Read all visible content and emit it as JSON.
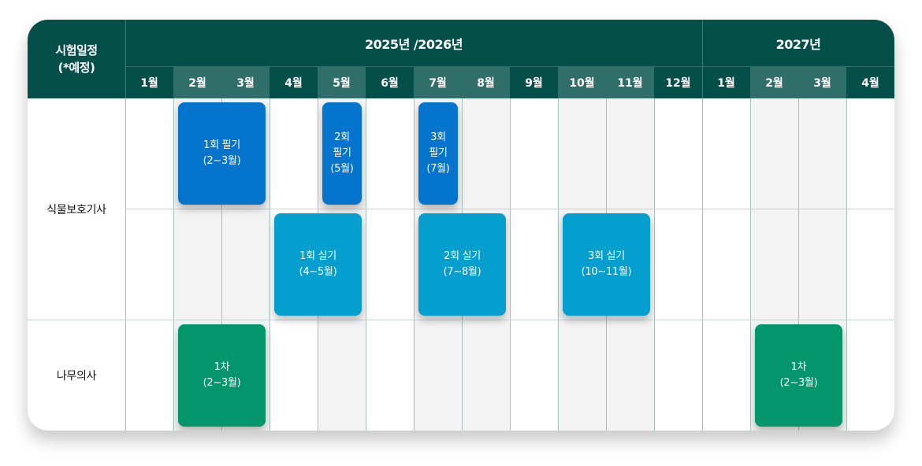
{
  "header": {
    "corner_line1": "시험일정",
    "corner_line2": "(*예정)",
    "year_range_label": "2025년 /2026년",
    "year_next_label": "2027년",
    "months": [
      "1월",
      "2월",
      "3월",
      "4월",
      "5월",
      "6월",
      "7월",
      "8월",
      "9월",
      "10월",
      "11월",
      "12월",
      "1월",
      "2월",
      "3월",
      "4월"
    ]
  },
  "rows": [
    {
      "label": "식물보호기사"
    },
    {
      "label": "나무의사"
    }
  ],
  "blocks": {
    "written1": {
      "lines": [
        "1회 필기",
        "(2~3월)"
      ]
    },
    "written2": {
      "lines": [
        "2회",
        "필기",
        "(5월)"
      ]
    },
    "written3": {
      "lines": [
        "3회",
        "필기",
        "(7월)"
      ]
    },
    "practical1": {
      "lines": [
        "1회 실기",
        "(4~5월)"
      ]
    },
    "practical2": {
      "lines": [
        "2회 실기",
        "(7~8월)"
      ]
    },
    "practical3": {
      "lines": [
        "3회 실기",
        "(10~11월)"
      ]
    },
    "tree1": {
      "lines": [
        "1차",
        "(2~3월)"
      ]
    },
    "tree2": {
      "lines": [
        "1차",
        "(2~3월)"
      ]
    }
  },
  "colors": {
    "header_bg": "#054f4b",
    "header_alt": "#2f6e69",
    "written": "#0474cc",
    "practical": "#049ecf",
    "tree": "#02966a"
  }
}
